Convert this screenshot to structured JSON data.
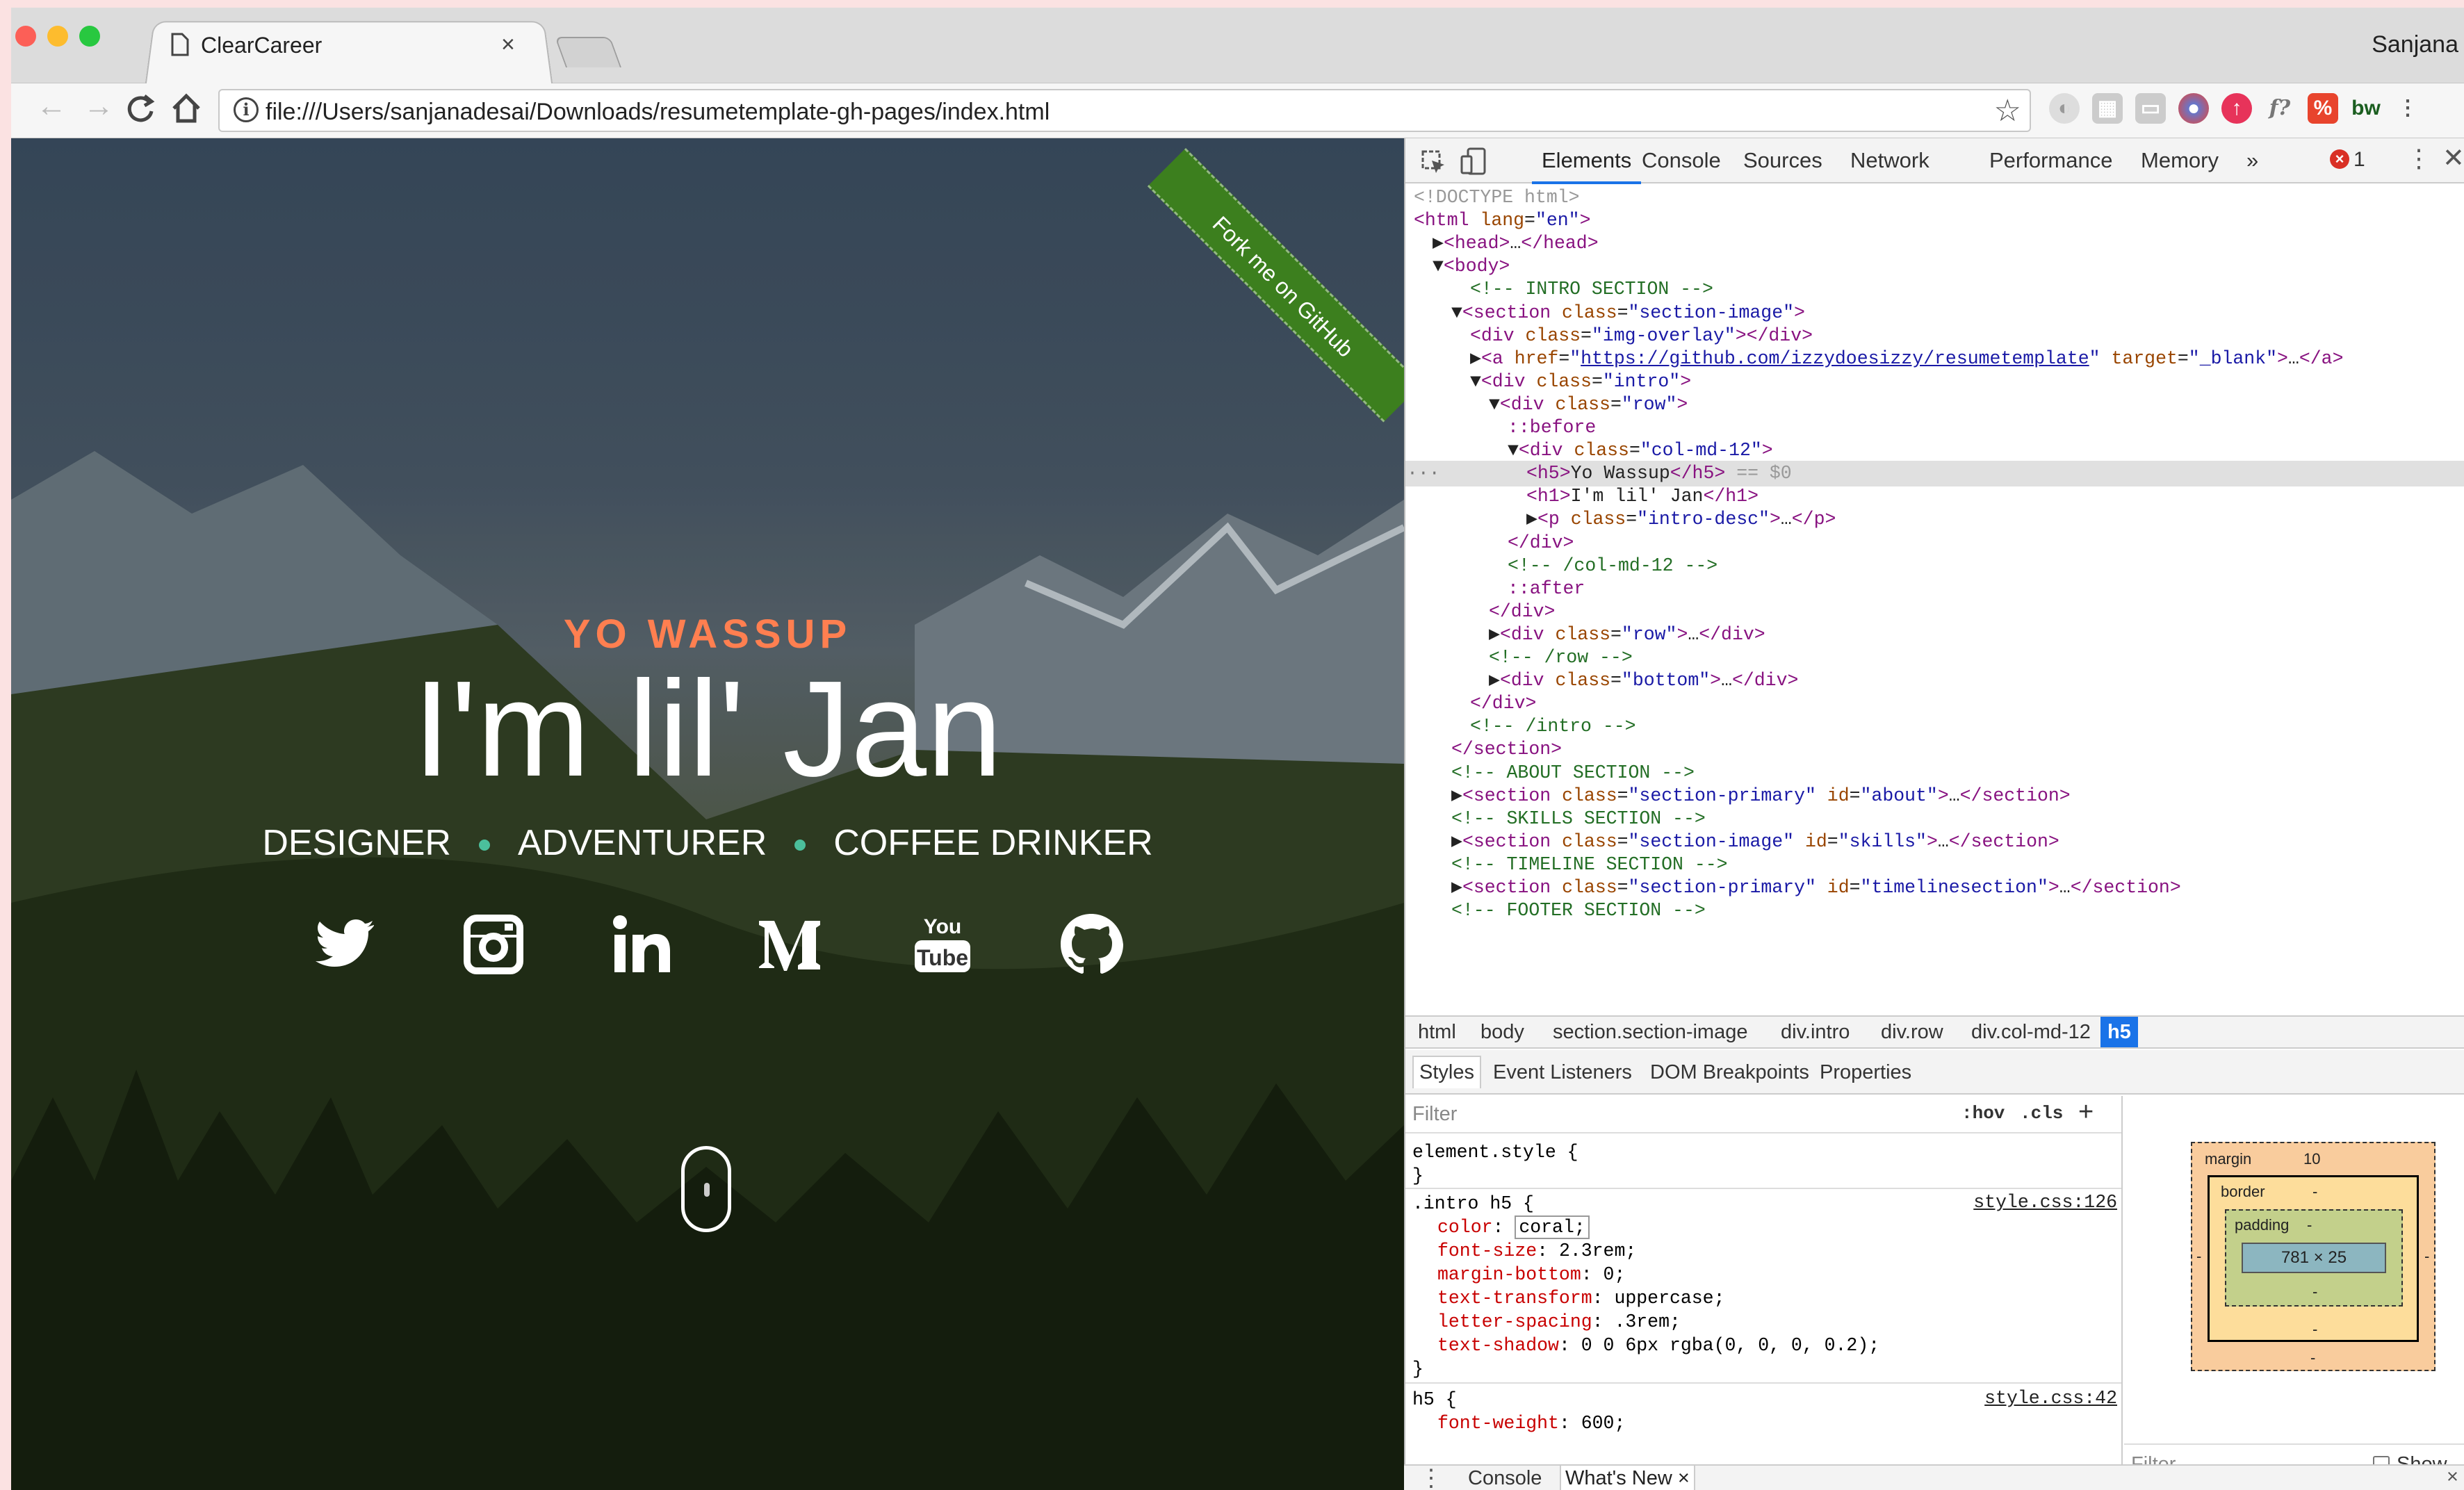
{
  "browser": {
    "tab_title": "ClearCareer",
    "tab_close": "×",
    "user": "Sanjana",
    "url": "file:///Users/sanjanadesai/Downloads/resumetemplate-gh-pages/index.html",
    "nav": {
      "back": "←",
      "forward": "→",
      "reload": "C",
      "home": "⌂"
    }
  },
  "page": {
    "ribbon": "Fork me on GitHub",
    "kicker": "Yo Wassup",
    "title": "I'm lil' Jan",
    "roles": [
      "DESIGNER",
      "ADVENTURER",
      "COFFEE DRINKER"
    ],
    "social": [
      "twitter-icon",
      "instagram-icon",
      "linkedin-icon",
      "medium-icon",
      "youtube-icon",
      "github-icon"
    ],
    "colors": {
      "kicker": "#ff7f50",
      "dot": "#4bbf9c"
    }
  },
  "devtools": {
    "tabs": [
      "Elements",
      "Console",
      "Sources",
      "Network",
      "Performance",
      "Memory",
      "»"
    ],
    "error_count": "1",
    "dom": [
      {
        "t": "<!DOCTYPE html>"
      },
      {
        "t": "<html lang=\"en\">"
      },
      {
        "t": "▶<head>…</head>"
      },
      {
        "t": "▼<body>"
      },
      {
        "t": "<!-- INTRO SECTION -->"
      },
      {
        "t": "▼<section class=\"section-image\">"
      },
      {
        "t": "<div class=\"img-overlay\"></div>"
      },
      {
        "t": "▶<a href=\"https://github.com/izzydoesizzy/resumetemplate\" target=\"_blank\">…</a>"
      },
      {
        "t": "▼<div class=\"intro\">"
      },
      {
        "t": "▼<div class=\"row\">"
      },
      {
        "t": "::before"
      },
      {
        "t": "▼<div class=\"col-md-12\">"
      },
      {
        "t": "<h5>Yo Wassup</h5> == $0"
      },
      {
        "t": "<h1>I'm lil' Jan</h1>"
      },
      {
        "t": "▶<p class=\"intro-desc\">…</p>"
      },
      {
        "t": "</div>"
      },
      {
        "t": "<!-- /col-md-12 -->"
      },
      {
        "t": "::after"
      },
      {
        "t": "</div>"
      },
      {
        "t": "▶<div class=\"row\">…</div>"
      },
      {
        "t": "<!-- /row -->"
      },
      {
        "t": "▶<div class=\"bottom\">…</div>"
      },
      {
        "t": "</div>"
      },
      {
        "t": "<!-- /intro -->"
      },
      {
        "t": "</section>"
      },
      {
        "t": "<!-- ABOUT SECTION -->"
      },
      {
        "t": "▶<section class=\"section-primary\" id=\"about\">…</section>"
      },
      {
        "t": "<!-- SKILLS SECTION -->"
      },
      {
        "t": "▶<section class=\"section-image\" id=\"skills\">…</section>"
      },
      {
        "t": "<!-- TIMELINE SECTION -->"
      },
      {
        "t": "▶<section class=\"section-primary\" id=\"timelinesection\">…</section>"
      },
      {
        "t": "<!-- FOOTER SECTION -->"
      }
    ],
    "breadcrumbs": [
      "html",
      "body",
      "section.section-image",
      "div.intro",
      "div.row",
      "div.col-md-12",
      "h5"
    ],
    "subtabs": [
      "Styles",
      "Event Listeners",
      "DOM Breakpoints",
      "Properties"
    ],
    "styles": {
      "filter_placeholder": "Filter",
      "hov": ":hov",
      "cls": ".cls",
      "add": "+",
      "element_style": "element.style {",
      "close": "}",
      "rule1_selector": ".intro h5 {",
      "rule1_source": "style.css:126",
      "rule1": [
        {
          "p": "color",
          "v": "coral;"
        },
        {
          "p": "font-size",
          "v": "2.3rem;"
        },
        {
          "p": "margin-bottom",
          "v": "0;"
        },
        {
          "p": "text-transform",
          "v": "uppercase;"
        },
        {
          "p": "letter-spacing",
          "v": ".3rem;"
        },
        {
          "p": "text-shadow",
          "v": "0 0 6px rgba(0, 0, 0, 0.2);"
        }
      ],
      "rule2_selector": "h5 {",
      "rule2_source": "style.css:42",
      "rule2": [
        {
          "p": "font-weight",
          "v": "600;"
        }
      ]
    },
    "boxmodel": {
      "margin_label": "margin",
      "margin_top": "10",
      "border_label": "border",
      "padding_label": "padding",
      "dash": "-",
      "content": "781 × 25",
      "filter": "Filter",
      "show_all": "Show al"
    },
    "drawer": {
      "console": "Console",
      "whats_new": "What's New",
      "close": "×"
    }
  }
}
